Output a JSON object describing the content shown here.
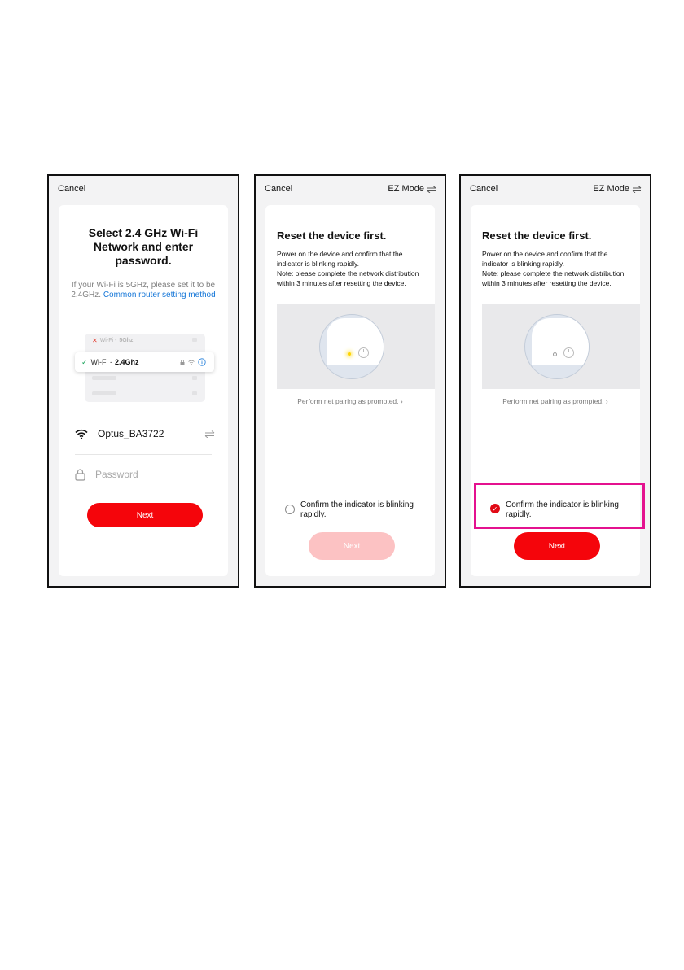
{
  "screen1": {
    "cancel": "Cancel",
    "title": "Select 2.4 GHz Wi-Fi Network and enter password.",
    "hint_prefix": "If your Wi-Fi is 5GHz, please set it to be 2.4GHz.",
    "hint_link": "Common router setting method",
    "wifi_5_prefix": "Wi-Fi -",
    "wifi_5_band": "5Ghz",
    "wifi_24_prefix": "Wi-Fi -",
    "wifi_24_band": "2.4Ghz",
    "ssid": "Optus_BA3722",
    "password_placeholder": "Password",
    "next_label": "Next"
  },
  "screen2": {
    "cancel": "Cancel",
    "mode": "EZ Mode",
    "title": "Reset the device first.",
    "description_1": "Power on the device and confirm that the indicator is blinking rapidly.",
    "description_2": "Note: please complete the network distribution within 3 minutes after resetting the device.",
    "prompt": "Perform net pairing as prompted.",
    "confirm_label": "Confirm the indicator is blinking rapidly.",
    "next_label": "Next"
  },
  "screen3": {
    "cancel": "Cancel",
    "mode": "EZ Mode",
    "title": "Reset the device first.",
    "description_1": "Power on the device and confirm that the indicator is blinking rapidly.",
    "description_2": "Note: please complete the network distribution within 3 minutes after resetting the device.",
    "prompt": "Perform net pairing as prompted.",
    "confirm_label": "Confirm the indicator is blinking rapidly.",
    "next_label": "Next"
  },
  "colors": {
    "accent": "#f5050b",
    "disabled_button": "#fcc2c3",
    "link": "#1677d8",
    "highlight_box": "#e4118f"
  }
}
